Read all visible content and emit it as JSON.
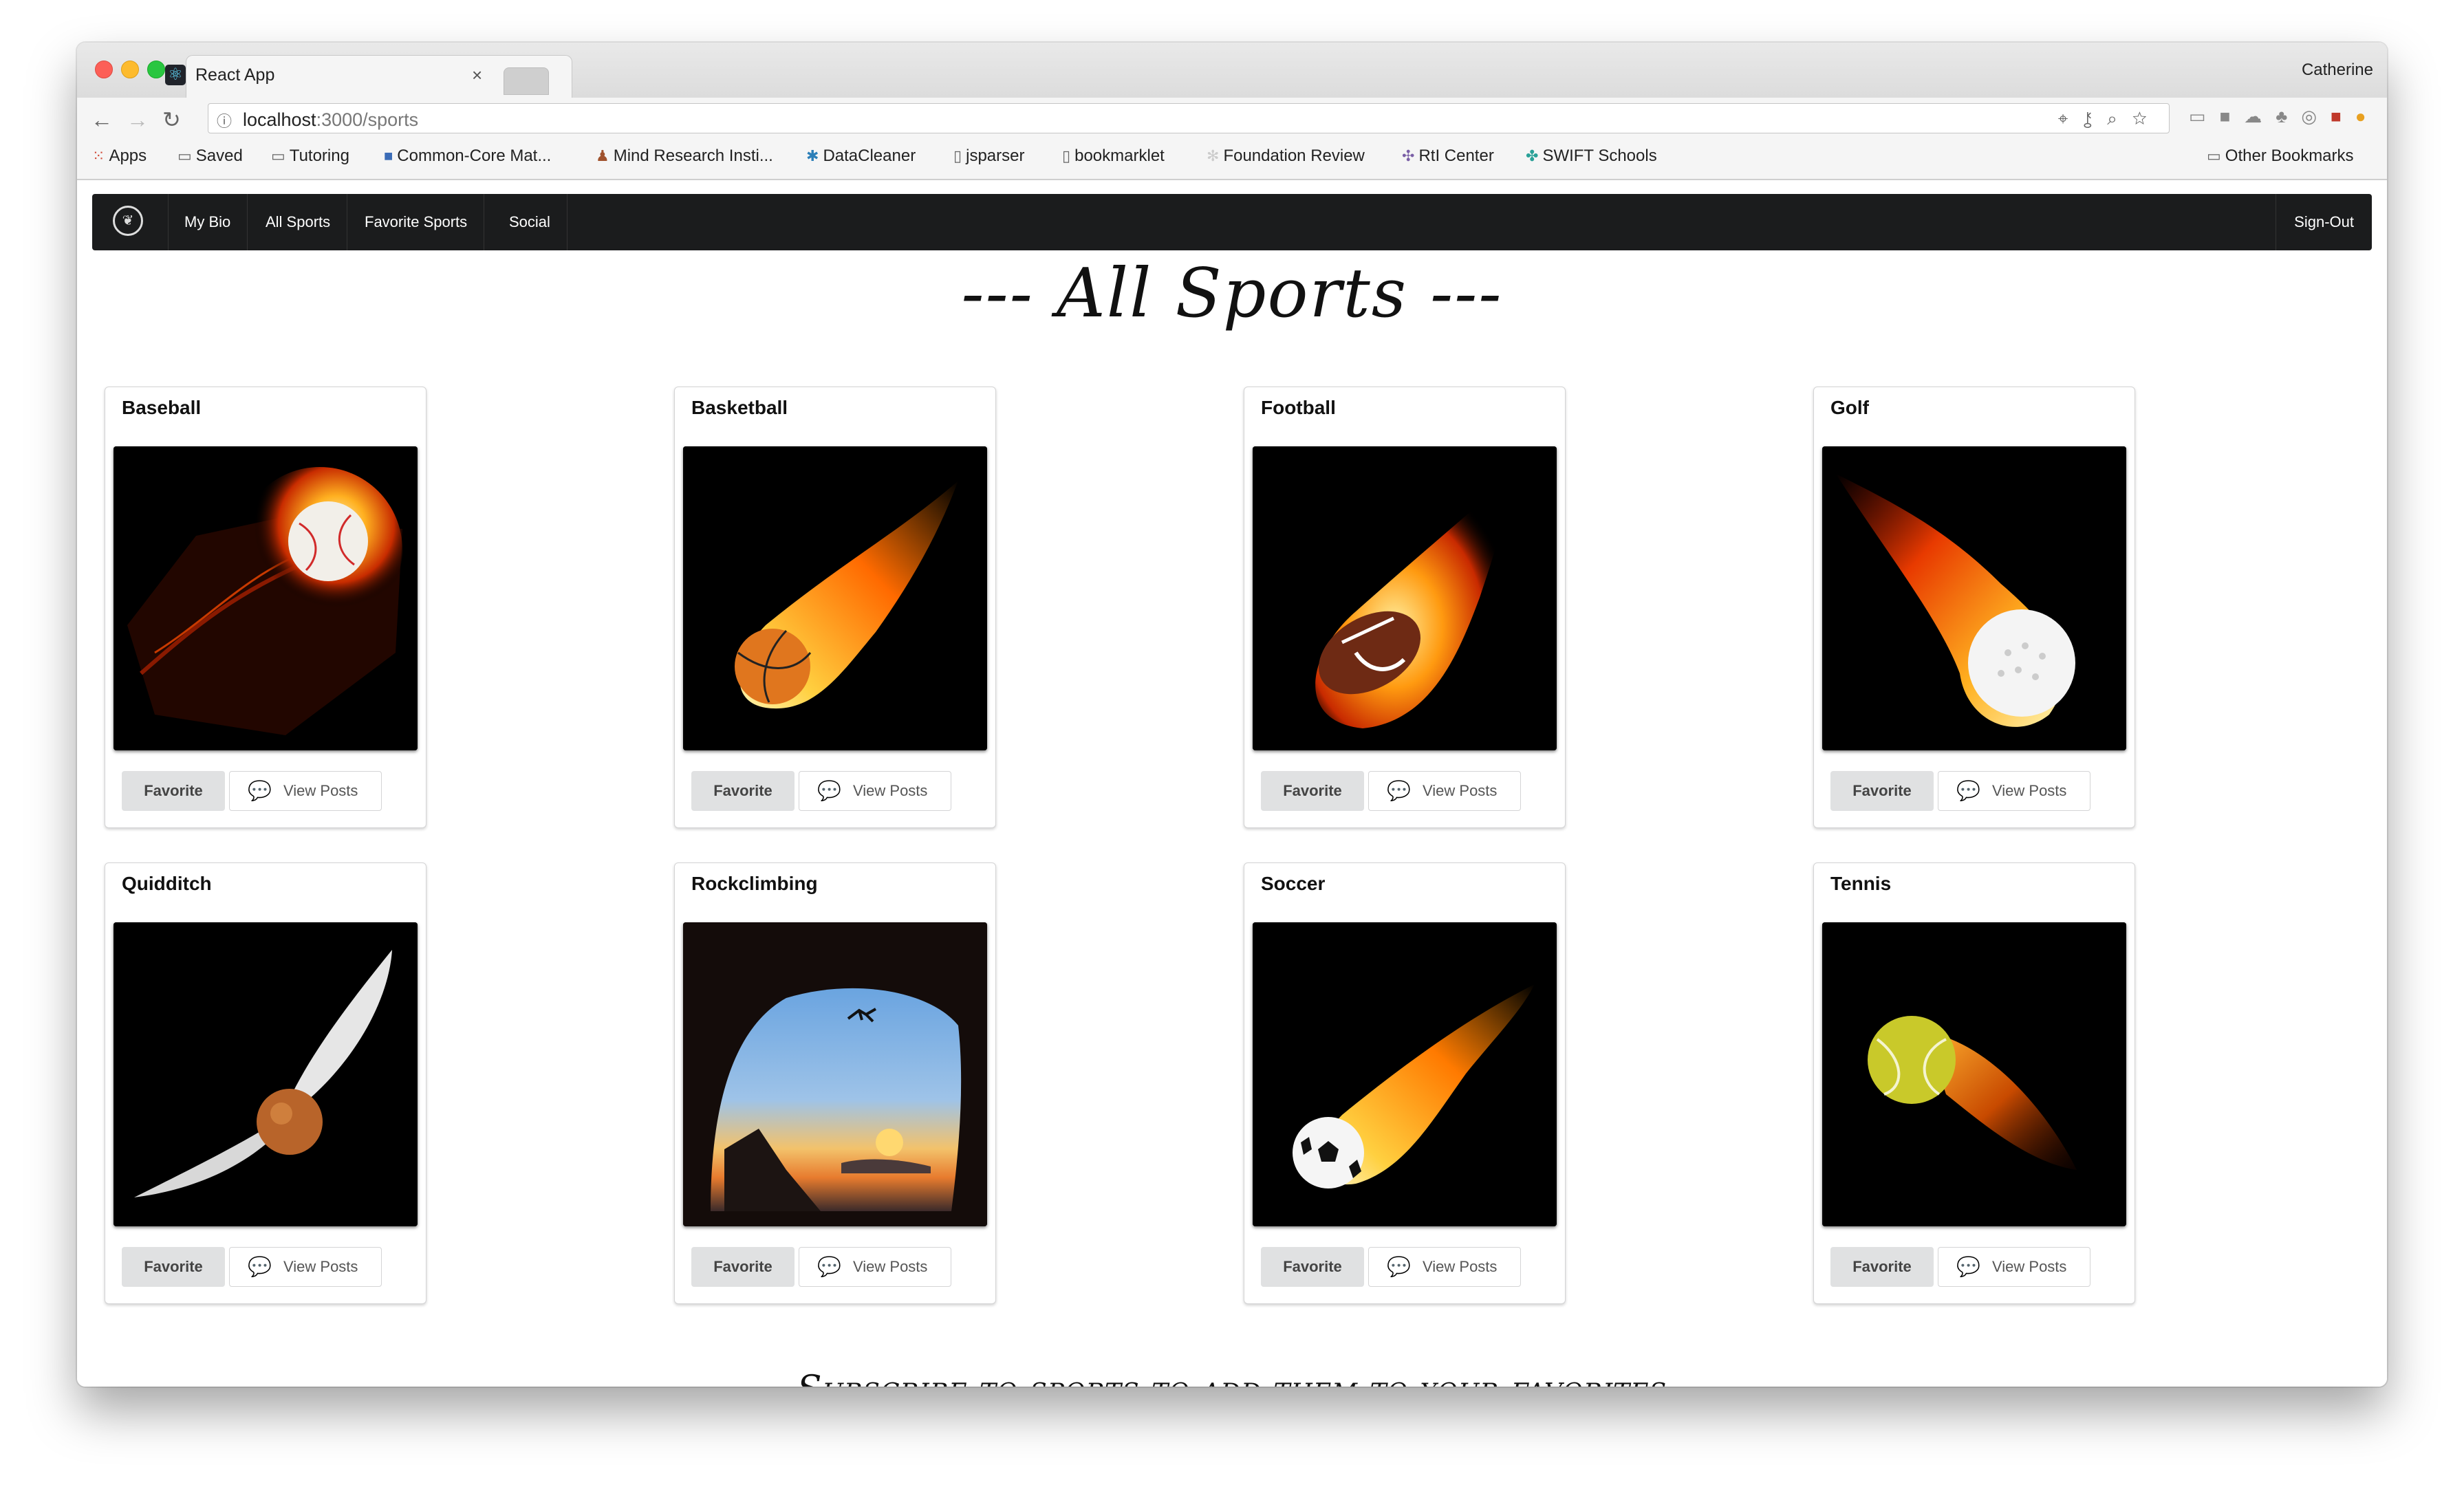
{
  "browser": {
    "tab_title": "React App",
    "tab_icon": "react-icon",
    "profile_name": "Catherine",
    "url_host": "localhost",
    "url_path": ":3000/sports",
    "bookmarks": [
      {
        "label": "Apps",
        "icon": "apps-grid-icon"
      },
      {
        "label": "Saved",
        "icon": "folder-icon"
      },
      {
        "label": "Tutoring",
        "icon": "folder-icon"
      },
      {
        "label": "Common-Core Mat...",
        "icon": "site-icon"
      },
      {
        "label": "Mind Research Insti...",
        "icon": "site-icon"
      },
      {
        "label": "DataCleaner",
        "icon": "site-icon"
      },
      {
        "label": "jsparser",
        "icon": "page-icon"
      },
      {
        "label": "bookmarklet",
        "icon": "page-icon"
      },
      {
        "label": "Foundation Review",
        "icon": "site-icon"
      },
      {
        "label": "RtI Center",
        "icon": "site-icon"
      },
      {
        "label": "SWIFT Schools",
        "icon": "site-icon"
      }
    ],
    "other_bookmarks": "Other Bookmarks"
  },
  "navbar": {
    "logo_icon": "crest-logo-icon",
    "items": [
      "My Bio",
      "All Sports",
      "Favorite Sports",
      "Social"
    ],
    "signout": "Sign-Out"
  },
  "page": {
    "title": "--- All Sports ---",
    "footer": "Subscribe to sports to add them to your favorites"
  },
  "sports": [
    {
      "name": "Baseball",
      "image": "flaming-baseball",
      "favorite_label": "Favorite",
      "view_label": "View Posts"
    },
    {
      "name": "Basketball",
      "image": "flaming-basketball",
      "favorite_label": "Favorite",
      "view_label": "View Posts"
    },
    {
      "name": "Football",
      "image": "flaming-football",
      "favorite_label": "Favorite",
      "view_label": "View Posts"
    },
    {
      "name": "Golf",
      "image": "flaming-golf-ball",
      "favorite_label": "Favorite",
      "view_label": "View Posts"
    },
    {
      "name": "Quidditch",
      "image": "golden-snitch",
      "favorite_label": "Favorite",
      "view_label": "View Posts"
    },
    {
      "name": "Rockclimbing",
      "image": "climber-in-cave-sunset",
      "favorite_label": "Favorite",
      "view_label": "View Posts"
    },
    {
      "name": "Soccer",
      "image": "flaming-soccer-ball",
      "favorite_label": "Favorite",
      "view_label": "View Posts"
    },
    {
      "name": "Tennis",
      "image": "flaming-tennis-ball",
      "favorite_label": "Favorite",
      "view_label": "View Posts"
    }
  ]
}
